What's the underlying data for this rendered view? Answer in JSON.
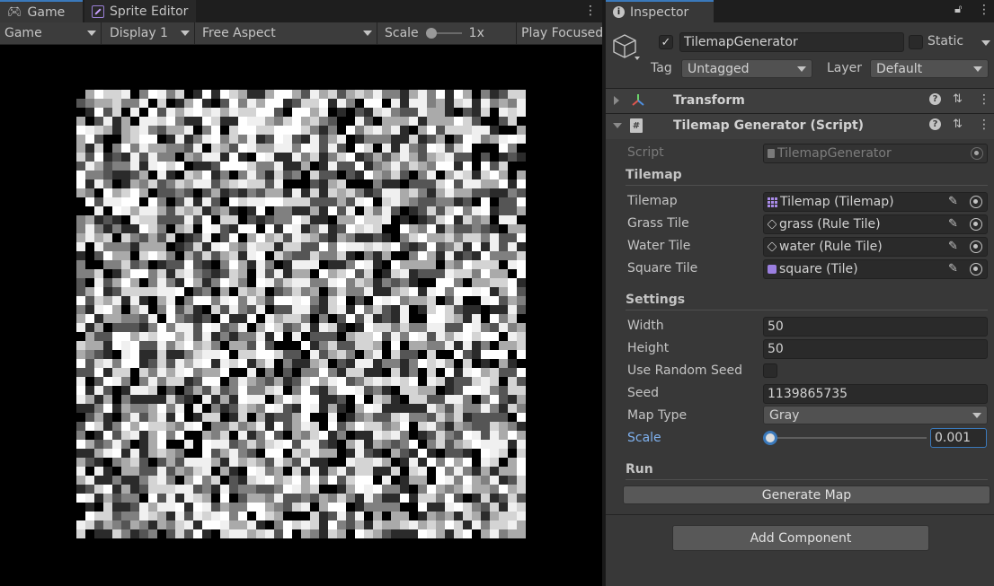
{
  "game_window": {
    "tabs": [
      {
        "label": "Game",
        "icon": "gamepad-icon"
      },
      {
        "label": "Sprite Editor",
        "icon": "sprite-editor-icon"
      }
    ],
    "toolbar": {
      "view_mode": "Game",
      "display": "Display 1",
      "aspect": "Free Aspect",
      "scale_label": "Scale",
      "scale_value": "1x",
      "play_mode": "Play Focused"
    },
    "viewport": {
      "description_colors": [
        "#000000",
        "#2b2b2b",
        "#555555",
        "#808080",
        "#aaaaaa",
        "#d4d4d4",
        "#f0f0f0",
        "#ffffff"
      ],
      "grid_size": 50
    }
  },
  "inspector": {
    "tab_label": "Inspector",
    "object": {
      "name": "TilemapGenerator",
      "static_label": "Static",
      "tag_label": "Tag",
      "tag_value": "Untagged",
      "layer_label": "Layer",
      "layer_value": "Default"
    },
    "components": {
      "transform": {
        "title": "Transform"
      },
      "script": {
        "title": "Tilemap Generator (Script)"
      }
    },
    "script_row": {
      "label": "Script",
      "value": "TilemapGenerator"
    },
    "sections": {
      "tilemap": "Tilemap",
      "settings": "Settings",
      "run": "Run"
    },
    "tilemap_fields": [
      {
        "label": "Tilemap",
        "value": "Tilemap (Tilemap)",
        "icon": "tilemap-icon"
      },
      {
        "label": "Grass Tile",
        "value": "grass (Rule Tile)",
        "icon": "rule-tile-icon"
      },
      {
        "label": "Water Tile",
        "value": "water (Rule Tile)",
        "icon": "rule-tile-icon"
      },
      {
        "label": "Square Tile",
        "value": "square (Tile)",
        "icon": "tile-icon"
      }
    ],
    "settings_fields": {
      "width": {
        "label": "Width",
        "value": "50"
      },
      "height": {
        "label": "Height",
        "value": "50"
      },
      "use_random_seed": {
        "label": "Use Random Seed",
        "checked": false
      },
      "seed": {
        "label": "Seed",
        "value": "1139865735"
      },
      "map_type": {
        "label": "Map Type",
        "value": "Gray"
      },
      "scale": {
        "label": "Scale",
        "value": "0.001",
        "slider_fraction": 0.0
      }
    },
    "buttons": {
      "generate": "Generate Map",
      "add_component": "Add Component"
    },
    "colors": {
      "accent": "#3a79bb",
      "panel_bg": "#383838",
      "field_bg": "#2a2a2a",
      "focus_label": "#7fb1ee"
    }
  }
}
